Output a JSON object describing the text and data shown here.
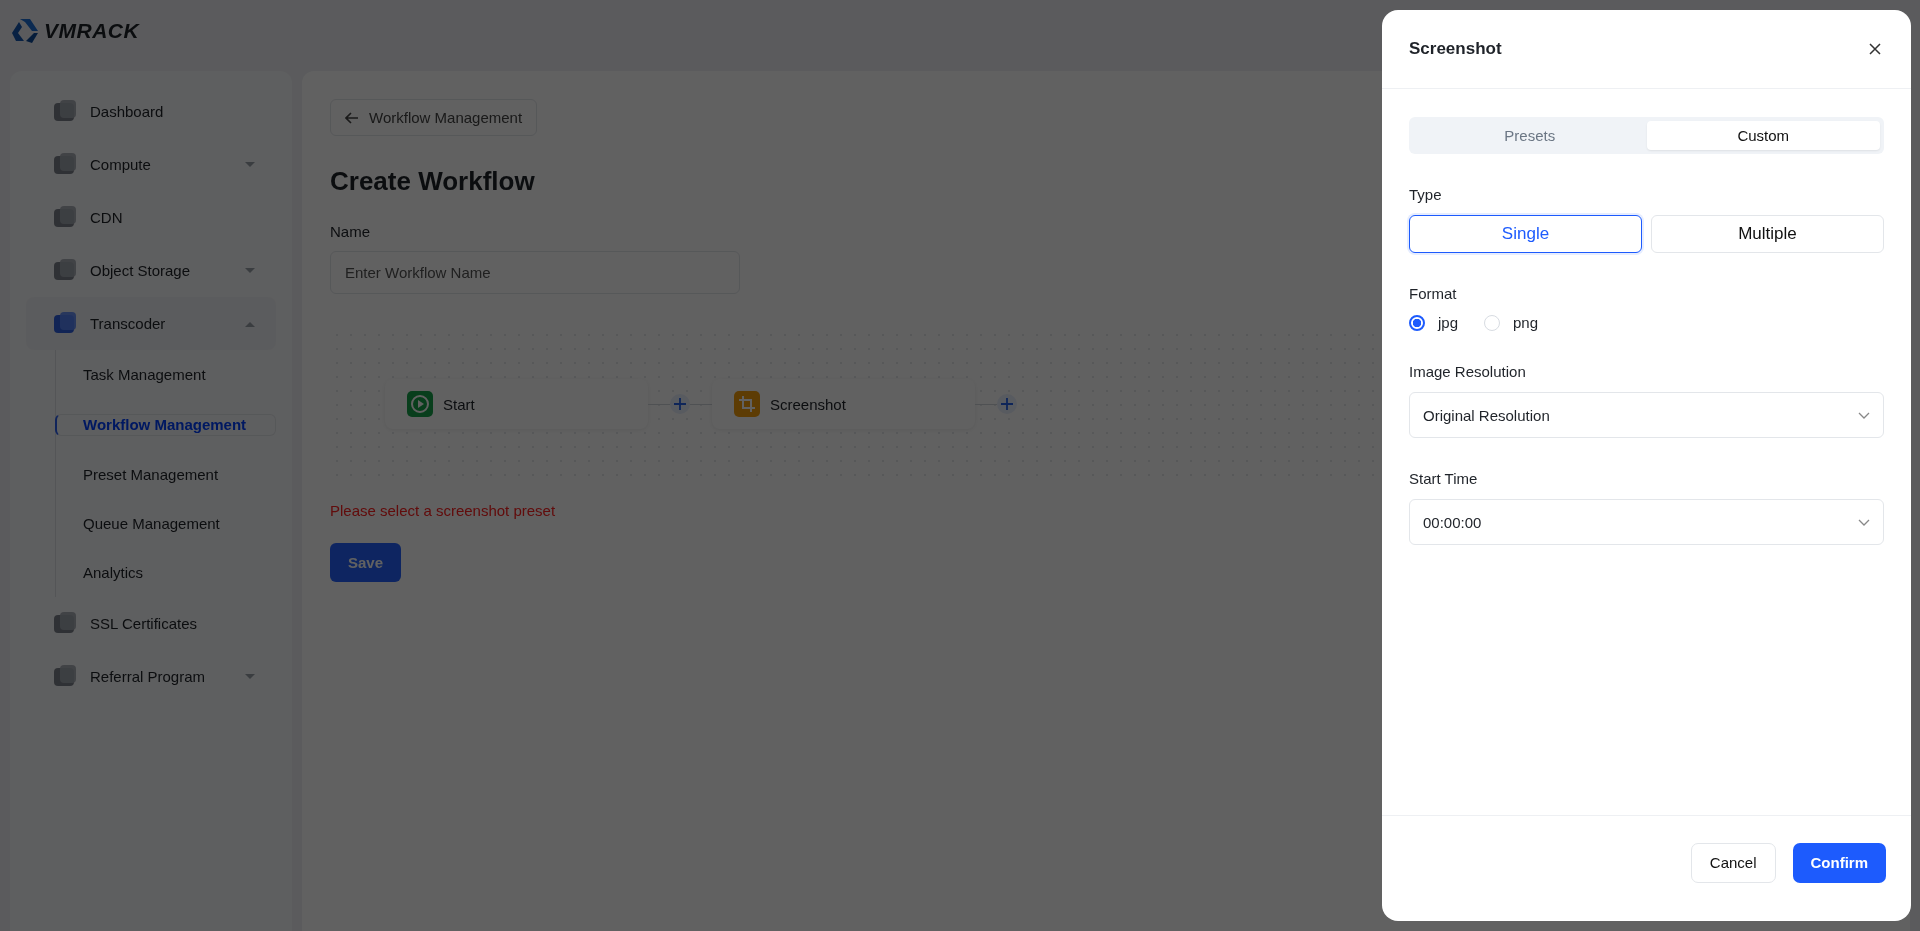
{
  "logo": {
    "text": "VMRACK"
  },
  "sidebar": {
    "items": [
      {
        "label": "Dashboard",
        "kind": "link",
        "expanded": false
      },
      {
        "label": "Compute",
        "kind": "group",
        "expanded": false
      },
      {
        "label": "CDN",
        "kind": "link",
        "expanded": false
      },
      {
        "label": "Object Storage",
        "kind": "group",
        "expanded": false
      },
      {
        "label": "Transcoder",
        "kind": "group",
        "expanded": true,
        "children": [
          {
            "label": "Task Management",
            "selected": false
          },
          {
            "label": "Workflow Management",
            "selected": true
          },
          {
            "label": "Preset Management",
            "selected": false
          },
          {
            "label": "Queue Management",
            "selected": false
          },
          {
            "label": "Analytics",
            "selected": false
          }
        ]
      },
      {
        "label": "SSL Certificates",
        "kind": "link",
        "expanded": false
      },
      {
        "label": "Referral Program",
        "kind": "group",
        "expanded": false
      }
    ]
  },
  "page": {
    "back_link": "Workflow Management",
    "title": "Create Workflow",
    "name_label": "Name",
    "name_placeholder": "Enter Workflow Name",
    "nodes": [
      {
        "label": "Start",
        "kind": "start"
      },
      {
        "label": "Screenshot",
        "kind": "screenshot"
      }
    ],
    "error": "Please select a screenshot preset",
    "save_button": "Save"
  },
  "drawer": {
    "title": "Screenshot",
    "tabs": [
      {
        "label": "Presets",
        "selected": false
      },
      {
        "label": "Custom",
        "selected": true
      }
    ],
    "type_label": "Type",
    "type_options": [
      {
        "label": "Single",
        "selected": true
      },
      {
        "label": "Multiple",
        "selected": false
      }
    ],
    "format_label": "Format",
    "formats": [
      {
        "label": "jpg",
        "selected": true
      },
      {
        "label": "png",
        "selected": false
      }
    ],
    "resolution_label": "Image Resolution",
    "resolution_value": "Original Resolution",
    "start_time_label": "Start Time",
    "start_time_value": "00:00:00",
    "cancel_button": "Cancel",
    "confirm_button": "Confirm"
  }
}
